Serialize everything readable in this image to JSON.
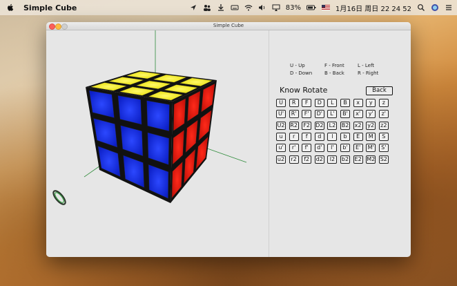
{
  "menubar": {
    "app_name": "Simple Cube",
    "battery": "83%",
    "clock": "1月16日 周日  22 24 52"
  },
  "window": {
    "title": "Simple Cube"
  },
  "legend": [
    {
      "text": "U - Up"
    },
    {
      "text": "F - Front"
    },
    {
      "text": "L - Left"
    },
    {
      "text": "D - Down"
    },
    {
      "text": "B - Back"
    },
    {
      "text": "R - Right"
    }
  ],
  "panel": {
    "heading": "Know Rotate",
    "back_label": "Back"
  },
  "move_rows": [
    [
      "U",
      "R",
      "F",
      "D",
      "L",
      "B",
      "x",
      "y",
      "z"
    ],
    [
      "U'",
      "R'",
      "F'",
      "D'",
      "L'",
      "B'",
      "x'",
      "y'",
      "z'"
    ],
    [
      "U2",
      "R2",
      "F2",
      "D2",
      "L2",
      "B2",
      "x2",
      "y2",
      "z2"
    ],
    [
      "u",
      "r",
      "f",
      "d",
      "l",
      "b",
      "E",
      "M",
      "S"
    ],
    [
      "u'",
      "r'",
      "f'",
      "d'",
      "l'",
      "b'",
      "E'",
      "M'",
      "S'"
    ],
    [
      "u2",
      "r2",
      "f2",
      "d2",
      "l2",
      "b2",
      "E2",
      "M2",
      "S2"
    ]
  ],
  "cube_colors": {
    "top": "#f2e600",
    "front": "#1326e0",
    "right": "#e51b12",
    "axis_x": "#2e8b3a",
    "axis_y": "#2e8b3a"
  }
}
